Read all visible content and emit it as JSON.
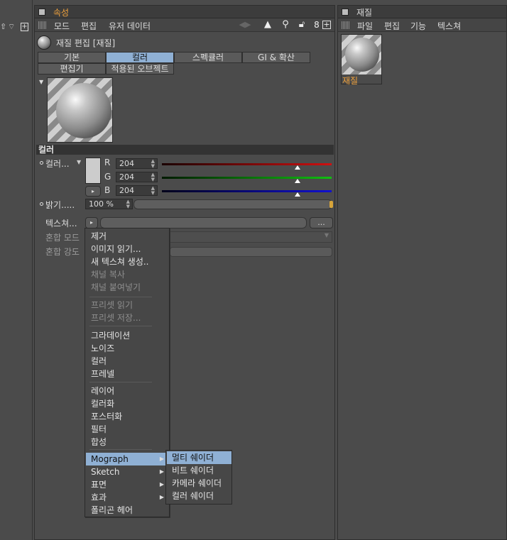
{
  "attr_panel": {
    "title": "속성",
    "menu": [
      "모드",
      "편집",
      "유저 데이터"
    ]
  },
  "material_header": {
    "title": "재질 편집 [재질]"
  },
  "tabs_row1": [
    {
      "label": "기본",
      "active": false
    },
    {
      "label": "컬러",
      "active": true
    },
    {
      "label": "스펙큘러",
      "active": false
    },
    {
      "label": "GI & 확산",
      "active": false
    }
  ],
  "tabs_row2": [
    {
      "label": "편집기",
      "active": false
    },
    {
      "label": "적용된 오브젝트",
      "active": false
    }
  ],
  "color_section": {
    "title": "컬러",
    "color_label": "컬러...",
    "r_label": "R",
    "g_label": "G",
    "b_label": "B",
    "r_value": "204",
    "g_value": "204",
    "b_value": "204",
    "r_fraction": 0.8,
    "g_fraction": 0.8,
    "b_fraction": 0.8,
    "brightness_label": "밝기.....",
    "brightness_value": "100 %",
    "texture_label": "텍스쳐...",
    "texture_more": "...",
    "blend_mode_label": "혼합 모드",
    "blend_strength_label": "혼합 강도"
  },
  "popup_menu": {
    "items": [
      {
        "label": "제거",
        "disabled": false
      },
      {
        "label": "이미지 읽기...",
        "disabled": false
      },
      {
        "label": "새 텍스쳐 생성..",
        "disabled": false
      },
      {
        "label": "채널 복사",
        "disabled": true
      },
      {
        "label": "채널 붙여넣기",
        "disabled": true
      },
      {
        "label": "프리셋 읽기",
        "disabled": true
      },
      {
        "label": "프리셋 저장...",
        "disabled": true
      },
      {
        "label": "그라데이션",
        "disabled": false
      },
      {
        "label": "노이즈",
        "disabled": false
      },
      {
        "label": "컬러",
        "disabled": false
      },
      {
        "label": "프레넬",
        "disabled": false
      },
      {
        "label": "레이어",
        "disabled": false
      },
      {
        "label": "컬러화",
        "disabled": false
      },
      {
        "label": "포스터화",
        "disabled": false
      },
      {
        "label": "필터",
        "disabled": false
      },
      {
        "label": "합성",
        "disabled": false
      },
      {
        "label": "Mograph",
        "disabled": false
      },
      {
        "label": "Sketch",
        "disabled": false
      },
      {
        "label": "표면",
        "disabled": false
      },
      {
        "label": "효과",
        "disabled": false
      },
      {
        "label": "폴리곤 헤어",
        "disabled": false
      }
    ]
  },
  "submenu": {
    "items": [
      "멀티 쉐이더",
      "비트 쉐이더",
      "카메라 쉐이더",
      "컬러 쉐이더"
    ]
  },
  "material_panel": {
    "title": "재질",
    "menu": [
      "파일",
      "편집",
      "기능",
      "텍스쳐"
    ],
    "thumb_label": "재질"
  },
  "colors": {
    "accent_title": "#f0a23c",
    "highlight": "#8fb0d4",
    "red": "#d01010",
    "green": "#10c010",
    "blue": "#1010d0"
  },
  "icons": [
    "back-forward-icon",
    "search-icon",
    "lock-icon",
    "link-icon",
    "new-panel-icon"
  ]
}
